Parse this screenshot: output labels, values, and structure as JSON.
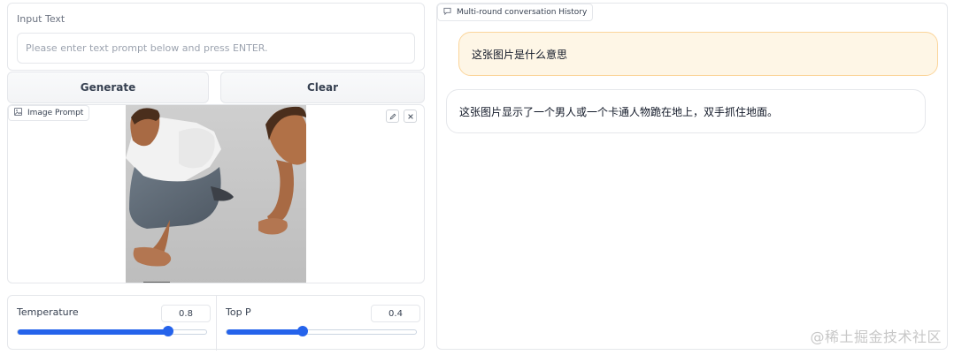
{
  "input": {
    "label": "Input Text",
    "placeholder": "Please enter text prompt below and press ENTER.",
    "value": ""
  },
  "buttons": {
    "generate_label": "Generate",
    "clear_label": "Clear"
  },
  "image_prompt": {
    "label": "Image Prompt",
    "edit_icon": "pencil-icon",
    "close_icon": "close-icon"
  },
  "sliders": [
    {
      "label": "Temperature",
      "value": "0.8",
      "level": 0.8
    },
    {
      "label": "Top P",
      "value": "0.4",
      "level": 0.4
    }
  ],
  "chat": {
    "label": "Multi-round conversation History",
    "messages": [
      {
        "role": "user",
        "text": "这张图片是什么意思"
      },
      {
        "role": "bot",
        "text": "这张图片显示了一个男人或一个卡通人物跪在地上，双手抓住地面。"
      }
    ]
  },
  "watermark": "@稀土掘金技术社区",
  "colors": {
    "accent": "#2563eb",
    "user_bubble": "#fef6e6",
    "user_bubble_border": "#fbd59b"
  }
}
